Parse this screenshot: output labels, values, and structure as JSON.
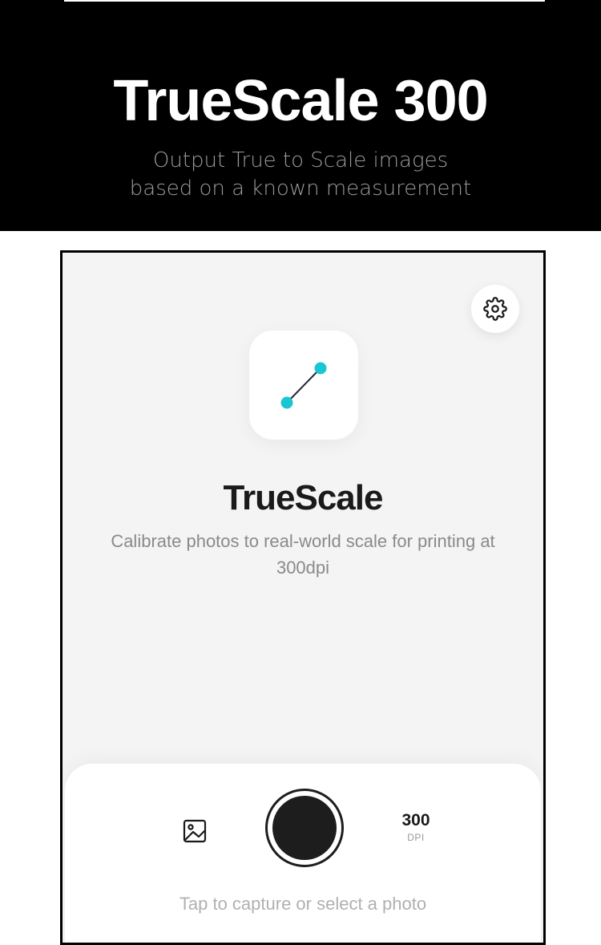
{
  "banner": {
    "title": "TrueScale 300",
    "subtitle_line1": "Output True to Scale images",
    "subtitle_line2": "based on a known measurement"
  },
  "app": {
    "name": "TrueScale",
    "description": "Calibrate photos to real-world scale for printing at 300dpi"
  },
  "controls": {
    "dpi_value": "300",
    "dpi_label": "DPI",
    "hint": "Tap to capture or select a photo"
  },
  "icons": {
    "settings": "gear-icon",
    "app_logo": "measure-line-icon",
    "gallery": "image-icon",
    "shutter": "capture-icon"
  },
  "colors": {
    "accent": "#19c6d2",
    "banner_bg": "#000000",
    "screen_bg": "#f4f4f4",
    "shutter": "#1d1d1d"
  }
}
